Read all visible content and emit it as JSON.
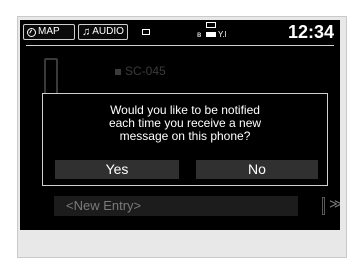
{
  "status_bar": {
    "map_label": "MAP",
    "audio_label": "AUDIO",
    "time": "12:34"
  },
  "background_list": {
    "top_entry": "SC-045",
    "new_entry": "<New Entry>"
  },
  "dialog": {
    "message_lines": [
      "Would you like to be notified",
      "each time you receive a new",
      "message on this phone?"
    ],
    "yes_label": "Yes",
    "no_label": "No"
  }
}
